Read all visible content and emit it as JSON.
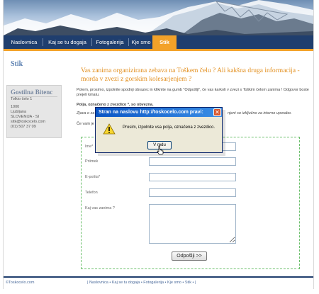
{
  "nav": {
    "items": [
      {
        "label": "Naslovnica",
        "active": false
      },
      {
        "label": "Kaj se tu dogaja",
        "active": false
      },
      {
        "label": "Fotogalerija",
        "active": false
      },
      {
        "label": "Kje smo",
        "active": false
      },
      {
        "label": "Stik",
        "active": true
      }
    ]
  },
  "sidebar": {
    "title": "Stik",
    "contact": {
      "name": "Gostilna Bitenc",
      "address1": "Tolkio čelo 1",
      "postcode": "1000",
      "city": "Ljubljana",
      "country": "SLOVENIJA - SI",
      "email": "sitk@toskocelo.com",
      "phone": "(01) 507 37 09"
    }
  },
  "main": {
    "title": "Vas zanima organizirana zebava na Toškem čelu ? Ali kakšna druga informacija - morda v zvezi z gorskim kolesarjenjem ?",
    "intro": "Potem, prosimo, izpolnite spodnji obrazec in kliknite na gumb \"Odpošlji\", če vas karkoli v zvezi s Toškim čelom zanima ! Odgovor boste prejeli kmalu.",
    "required_note": "Polja, označeno z zvezdico *, so obvezna.",
    "privacy_note": "Zjava o za",
    "privacy_note_end": "njeni so izključno za interno uporabo.",
    "cut_text": "Če vam je",
    "form": {
      "fields": [
        {
          "label": "Ime*",
          "value": ""
        },
        {
          "label": "Priimek",
          "value": ""
        },
        {
          "label": "E-pošta*",
          "value": ""
        },
        {
          "label": "Telefon",
          "value": ""
        }
      ],
      "message_label": "Kaj vas zanima ?",
      "message_value": "",
      "submit_label": "Odpošlji >>"
    }
  },
  "footer": {
    "copyright": "©Toskocelo.com",
    "links": "| Naslovnica • Kaj se tu dogaja • Fotogalerija • Kje smo • Stik • |"
  },
  "dialog": {
    "title": "Stran na naslovu http://toskocelo.com pravi:",
    "message": "Prosim, izpolnite vsa polja, označena z zvezdico.",
    "ok_label": "V redu",
    "icon": "warning-icon"
  },
  "colors": {
    "nav_bg": "#1f3e6e",
    "accent": "#f3a229",
    "title_orange": "#e28d1a",
    "form_border": "#6bbf6b",
    "dialog_title": "#0a55c4"
  }
}
